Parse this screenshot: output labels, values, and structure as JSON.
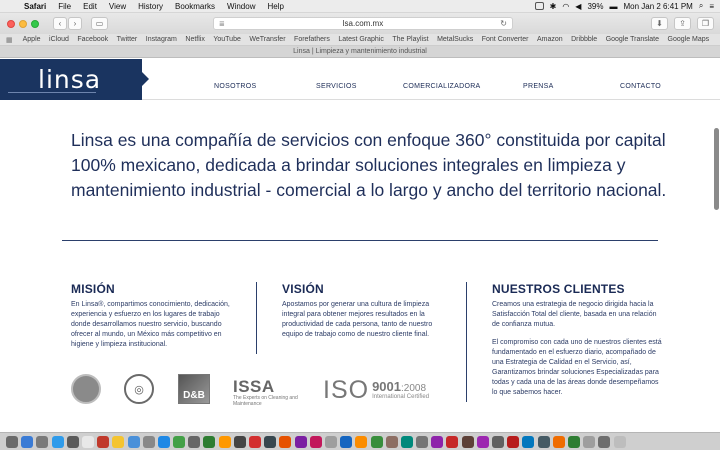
{
  "menubar": {
    "items": [
      "Safari",
      "File",
      "Edit",
      "View",
      "History",
      "Bookmarks",
      "Window",
      "Help"
    ],
    "battery": "39%",
    "clock": "Mon Jan 2  6:41 PM"
  },
  "browser": {
    "url": "lsa.com.mx",
    "tab_title": "Linsa | Limpieza y mantenimiento industrial",
    "bookmarks": [
      "Apple",
      "iCloud",
      "Facebook",
      "Twitter",
      "Instagram",
      "Netflix",
      "YouTube",
      "WeTransfer",
      "Forefathers",
      "Latest Graphic",
      "The Playlist",
      "MetalSucks",
      "Font Converter",
      "Amazon",
      "Dribbble",
      "Google Translate",
      "Google Maps"
    ]
  },
  "site": {
    "logo": "linsa",
    "nav": [
      "NOSOTROS",
      "SERVICIOS",
      "COMERCIALIZADORA",
      "PRENSA",
      "CONTACTO"
    ],
    "intro": "Linsa es una compañía de servicios con enfoque 360° constituida por capital 100% mexicano, dedicada a brindar soluciones integrales en limpieza y mantenimiento industrial - comercial a lo largo y ancho del territorio nacional.",
    "mision": {
      "title": "MISIÓN",
      "text": "En Linsa®, compartimos conocimiento, dedicación, experiencia y esfuerzo en los lugares de trabajo donde desarrollamos nuestro servicio, buscando ofrecer al mundo, un México más competitivo en higiene y limpieza institucional."
    },
    "vision": {
      "title": "VISIÓN",
      "text": "Apostamos por generar una cultura de limpieza integral para obtener mejores resultados en la productividad de cada persona, tanto de nuestro equipo de trabajo como de nuestro cliente final."
    },
    "clientes": {
      "title": "NUESTROS CLIENTES",
      "text1": "Creamos una estrategia de negocio dirigida hacia la Satisfacción Total del cliente, basada en una relación de confianza mutua.",
      "text2": "El compromiso con cada uno de nuestros clientes está fundamentado en el esfuerzo diario, acompañado de una Estrategia de Calidad en el Servicio, así, Garantizamos brindar soluciones Especializadas para todas y cada una de las áreas donde desempeñamos lo que sabemos hacer."
    },
    "certs": {
      "dnb": "D&B",
      "issa": "ISSA",
      "issa_sub": "The Experts on Cleaning and Maintenance",
      "iso": "ISO",
      "iso_num": "9001",
      "iso_year": ":2008",
      "iso_sub": "International Certified"
    }
  },
  "colors": {
    "brand_navy": "#1a3460",
    "text_navy": "#1f2f5a"
  }
}
